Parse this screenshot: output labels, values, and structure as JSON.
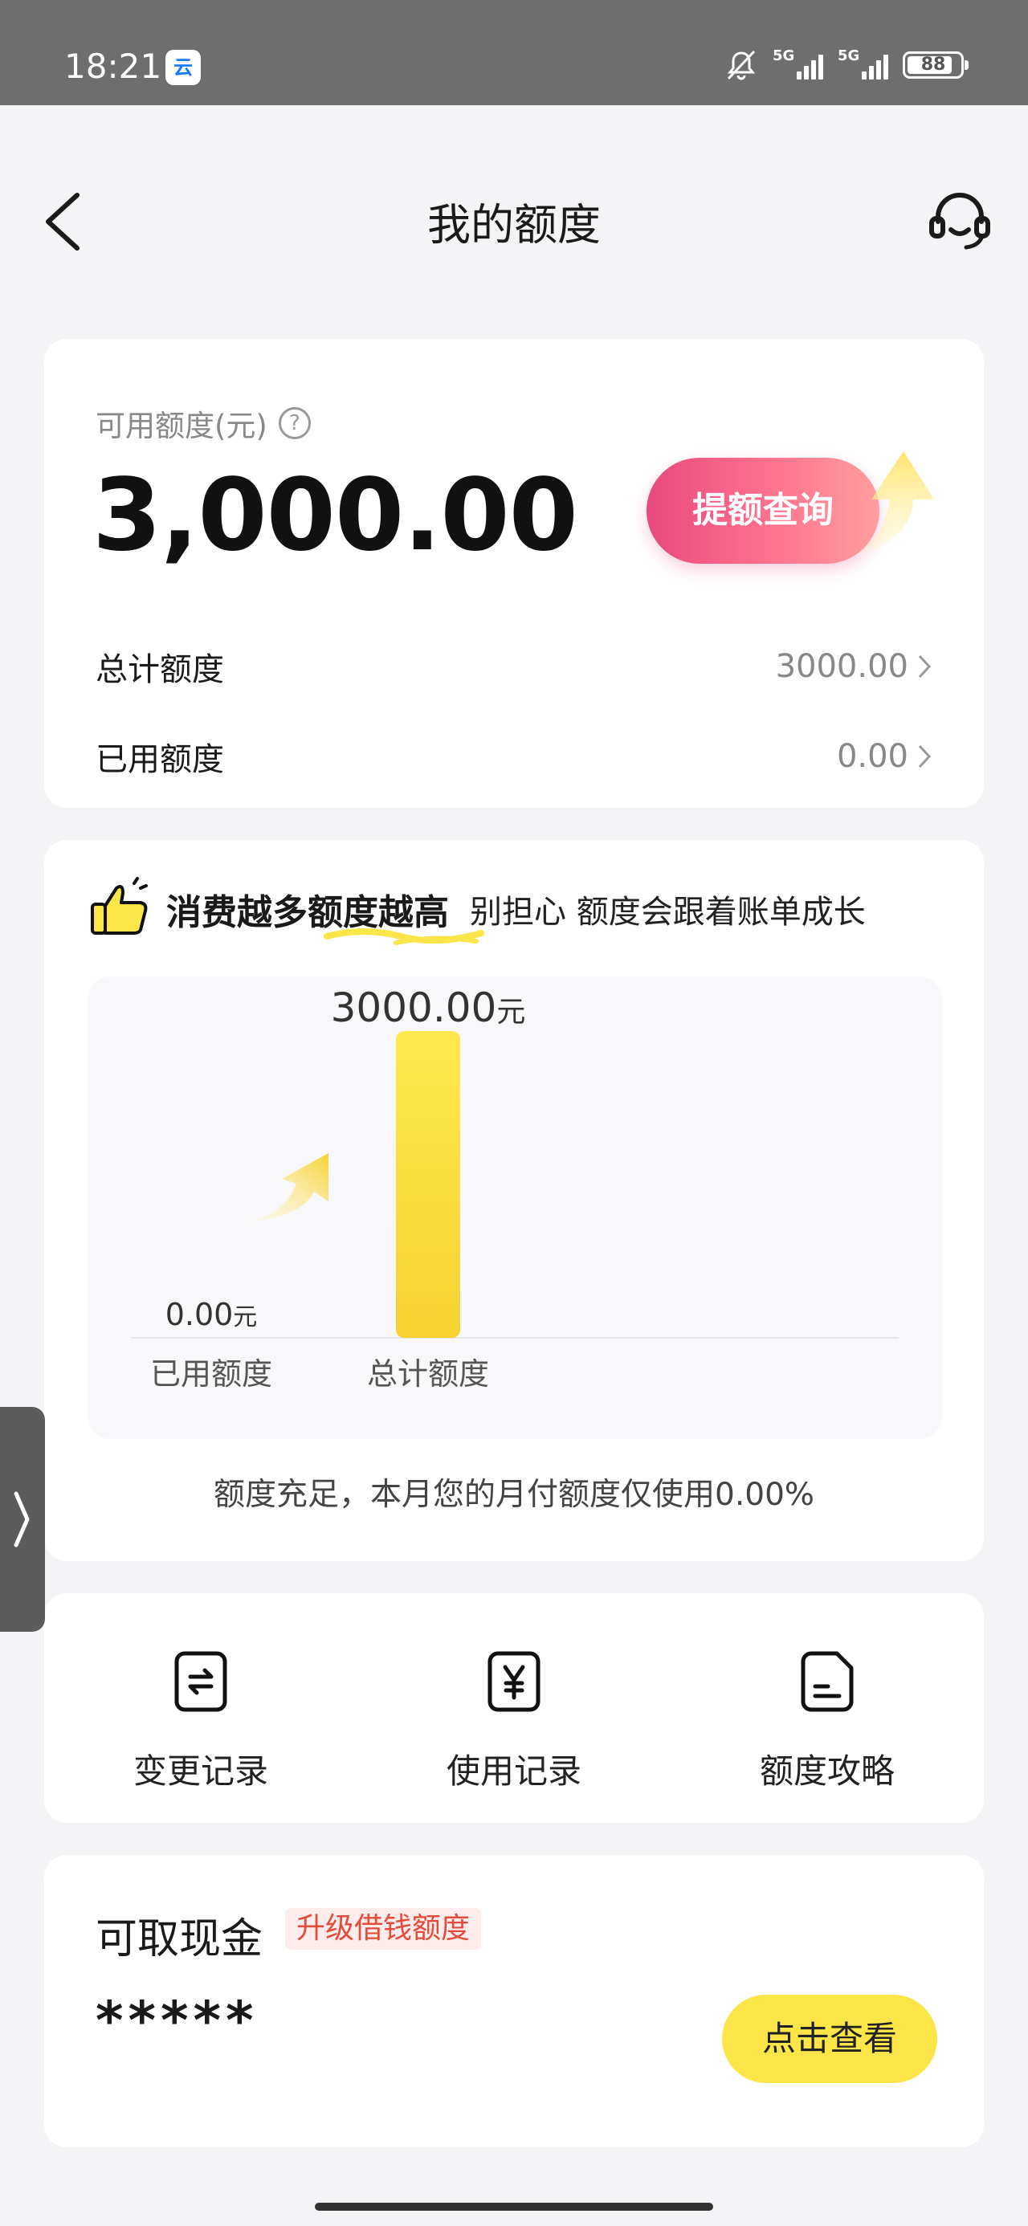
{
  "status_bar": {
    "time": "18:21",
    "app_icon_label": "云",
    "network_1": "5G",
    "network_2": "5G",
    "battery": "88"
  },
  "header": {
    "title": "我的额度",
    "back_icon": "chevron-left-icon",
    "support_icon": "headset-icon"
  },
  "quota": {
    "available_label": "可用额度(元)",
    "available_amount": "3,000.00",
    "raise_button": "提额查询",
    "rows": [
      {
        "label": "总计额度",
        "value": "3000.00"
      },
      {
        "label": "已用额度",
        "value": "0.00"
      }
    ]
  },
  "growth": {
    "headline": "消费越多额度越高",
    "sub": "别担心 额度会跟着账单成长",
    "note": "额度充足，本月您的月付额度仅使用0.00%"
  },
  "chart_data": {
    "type": "bar",
    "categories": [
      "已用额度",
      "总计额度"
    ],
    "values": [
      0.0,
      3000.0
    ],
    "value_labels": [
      "0.00",
      "3000.00"
    ],
    "unit": "元",
    "ylim": [
      0,
      3000
    ],
    "bar_color": "#fce548"
  },
  "records": [
    {
      "label": "变更记录",
      "icon": "exchange-doc-icon"
    },
    {
      "label": "使用记录",
      "icon": "yuan-doc-icon"
    },
    {
      "label": "额度攻略",
      "icon": "guide-doc-icon"
    }
  ],
  "cash": {
    "title": "可取现金",
    "badge": "升级借钱额度",
    "masked_value": "*****",
    "view_button": "点击查看"
  },
  "colors": {
    "accent_yellow": "#fce548",
    "accent_pink": "#e8487e",
    "badge_red": "#e34b3b"
  }
}
